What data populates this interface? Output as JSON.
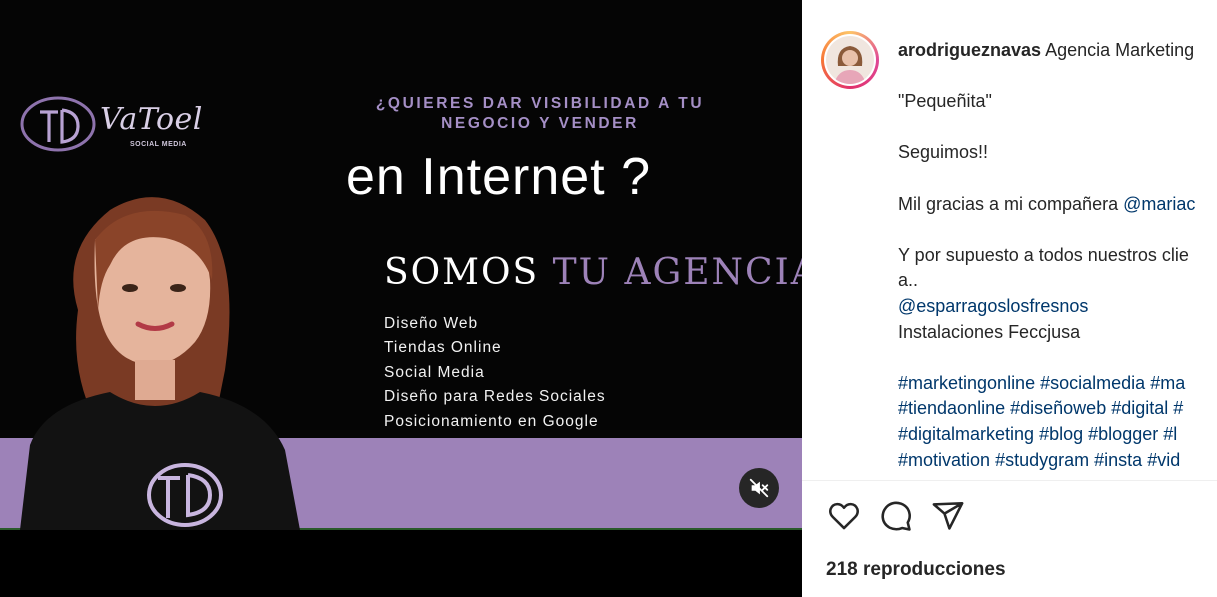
{
  "video": {
    "logo_text": "VaToel",
    "logo_subtext": "SOCIAL MEDIA",
    "headline_small_line1": "¿QUIERES DAR VISIBILIDAD A TU",
    "headline_small_line2": "NEGOCIO Y VENDER",
    "headline_big": "en Internet ?",
    "agency_prefix": "SOMOS ",
    "agency_accent": "TU AGENCIA",
    "services": [
      "Diseño Web",
      "Tiendas Online",
      "Social Media",
      "Diseño para Redes Sociales",
      "Posicionamiento en Google"
    ],
    "mute_icon": "speaker-muted-icon",
    "accent_color": "#9d82b8"
  },
  "post": {
    "username": "arodrigueznavas",
    "account_name": "Agencia Marketing",
    "lines": {
      "quote": "\"Pequeñita\"",
      "seguimos": "Seguimos!!",
      "thanks_prefix": "Mil gracias a mi compañera ",
      "thanks_mention": "@mariac",
      "clients_line1": "Y por supuesto a todos nuestros clie",
      "clients_line2": "a..",
      "mention_2": "@esparragoslosfresnos",
      "plain_1": "Instalaciones Feccjusa"
    },
    "hashtag_rows": [
      [
        "#marketingonline",
        "#socialmedia",
        "#ma"
      ],
      [
        "#tiendaonline",
        "#diseñoweb",
        "#digital",
        "#"
      ],
      [
        "#digitalmarketing",
        "#blog",
        "#blogger",
        "#l"
      ],
      [
        "#motivation",
        "#studygram",
        "#insta",
        "#vid"
      ]
    ],
    "actions": [
      "heart-icon",
      "comment-icon",
      "share-icon"
    ],
    "views_text": "218 reproducciones",
    "link_color": "#00376b"
  }
}
